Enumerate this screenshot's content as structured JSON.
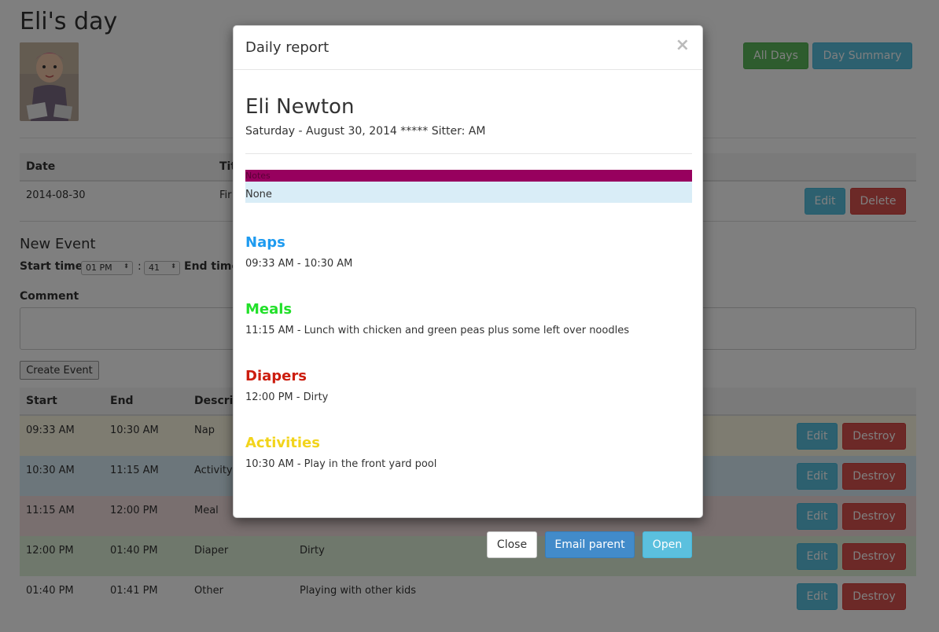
{
  "page": {
    "title": "Eli's day",
    "all_days_label": "All Days",
    "day_summary_label": "Day Summary"
  },
  "day_table": {
    "headers": [
      "Date",
      "Title"
    ],
    "row": {
      "date": "2014-08-30",
      "title": "Fir"
    },
    "edit_label": "Edit",
    "delete_label": "Delete"
  },
  "new_event": {
    "heading": "New Event",
    "start_label": "Start time",
    "start_hour": "01 PM",
    "start_min": "41",
    "colon": ":",
    "end_label": "End time",
    "comment_label": "Comment",
    "create_label": "Create Event"
  },
  "events": {
    "headers": [
      "Start",
      "End",
      "Descrip"
    ],
    "edit_label": "Edit",
    "destroy_label": "Destroy",
    "rows": [
      {
        "start": "09:33 AM",
        "end": "10:30 AM",
        "desc": "Nap",
        "comment": "",
        "color": "#fcf8e3"
      },
      {
        "start": "10:30 AM",
        "end": "11:15 AM",
        "desc": "Activity",
        "comment": "",
        "color": "#d9edf7"
      },
      {
        "start": "11:15 AM",
        "end": "12:00 PM",
        "desc": "Meal",
        "comment": "",
        "color": "#f2dede"
      },
      {
        "start": "12:00 PM",
        "end": "01:40 PM",
        "desc": "Diaper",
        "comment": "Dirty",
        "color": "#dff0d8"
      },
      {
        "start": "01:40 PM",
        "end": "01:41 PM",
        "desc": "Other",
        "comment": "Playing with other kids",
        "color": "#ffffff"
      }
    ]
  },
  "modal": {
    "title": "Daily report",
    "close_glyph": "×",
    "child_name": "Eli Newton",
    "meta": "Saturday - August 30, 2014 ***** Sitter: AM",
    "notes_label": "Notes",
    "notes_value": "None",
    "sections": [
      {
        "title": "Naps",
        "color": "#1e9bf0",
        "text": "09:33 AM - 10:30 AM"
      },
      {
        "title": "Meals",
        "color": "#22e02a",
        "text": "11:15 AM - Lunch with chicken and green peas plus some left over noodles"
      },
      {
        "title": "Diapers",
        "color": "#cc1d0f",
        "text": "12:00 PM - Dirty"
      },
      {
        "title": "Activities",
        "color": "#f2d41c",
        "text": "10:30 AM - Play in the front yard pool"
      }
    ],
    "close_label": "Close",
    "email_label": "Email parent",
    "open_label": "Open"
  }
}
